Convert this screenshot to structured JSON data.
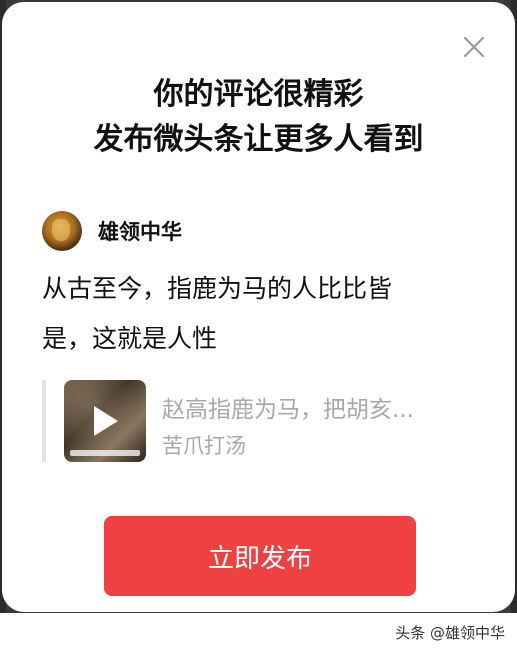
{
  "dialog": {
    "title_line1": "你的评论很精彩",
    "title_line2": "发布微头条让更多人看到",
    "close_icon": "close-icon"
  },
  "user": {
    "name": "雄领中华"
  },
  "comment": {
    "line1": "从古至今，指鹿为马的人比比皆",
    "line2": "是，这就是人性"
  },
  "quote": {
    "title": "赵高指鹿为马，把胡亥...",
    "author": "苦爪打汤",
    "thumb_icon": "play-icon"
  },
  "actions": {
    "publish_label": "立即发布"
  },
  "watermark": {
    "text": "头条 @雄领中华"
  },
  "colors": {
    "accent": "#f04142",
    "muted_text": "#a8a8a8"
  }
}
